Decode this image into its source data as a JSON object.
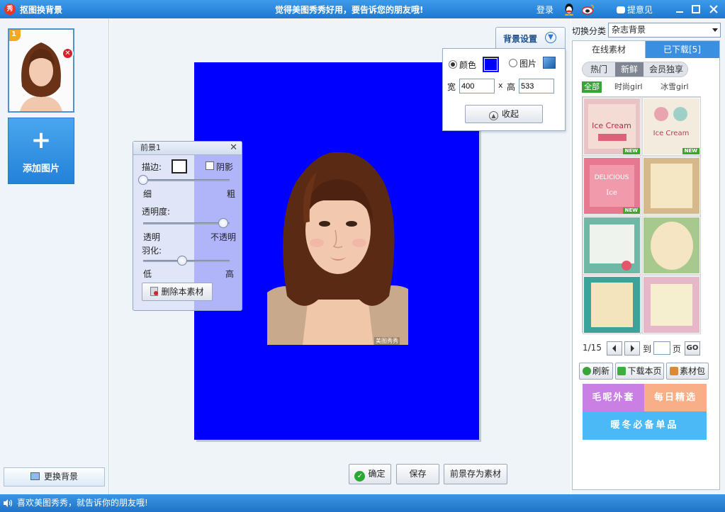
{
  "titlebar": {
    "logo": "秀",
    "title": "抠图换背景",
    "slogan": "觉得美图秀秀好用，要告诉您的朋友哦!",
    "login": "登录",
    "feedback": "提意见",
    "minimize_icon": "minimize-icon",
    "maximize_icon": "maximize-icon",
    "close_icon": "close-icon"
  },
  "left": {
    "thumb_badge": "1",
    "add_label": "添加图片",
    "add_plus": "+",
    "change_bg_label": "更换背景"
  },
  "canvas": {
    "bg_color": "#0000ff",
    "watermark": "美图秀秀"
  },
  "foreground_panel": {
    "title": "前景1",
    "stroke_label": "描边:",
    "shadow_label": "阴影",
    "thin": "细",
    "thick": "粗",
    "opacity_label": "透明度:",
    "transparent": "透明",
    "opaque": "不透明",
    "feather_label": "羽化:",
    "low": "低",
    "high": "高",
    "stroke_value": 0.0,
    "opacity_value": 0.93,
    "feather_value": 0.45,
    "delete_label": "删除本素材"
  },
  "bg_panel": {
    "tab_label": "背景设置",
    "color_label": "颜色",
    "image_label": "图片",
    "width_label": "宽",
    "width_value": "400",
    "x_label": "x",
    "height_label": "高",
    "height_value": "533",
    "collapse_label": "收起",
    "selected": "color"
  },
  "bottom_buttons": {
    "ok": "确定",
    "save": "保存",
    "save_as": "前景存为素材"
  },
  "right": {
    "category_label": "切换分类",
    "category_value": "杂志背景",
    "tabs": [
      {
        "label": "在线素材"
      },
      {
        "label": "已下载[5]"
      }
    ],
    "subtabs": [
      {
        "label": "热门"
      },
      {
        "label": "新鲜"
      },
      {
        "label": "会员独享"
      }
    ],
    "filters": [
      {
        "label": "全部"
      },
      {
        "label": "时尚girl"
      },
      {
        "label": "冰雪girl"
      }
    ],
    "tiles": [
      {
        "new": "NEW"
      },
      {
        "new": "NEW"
      },
      {
        "new": "NEW"
      },
      {
        "new": ""
      },
      {
        "new": ""
      },
      {
        "new": ""
      },
      {
        "new": ""
      },
      {
        "new": ""
      }
    ],
    "pager": {
      "page": "1/15",
      "to": "到",
      "unit": "页",
      "go": "GO"
    },
    "actions": {
      "refresh": "刷新",
      "download": "下载本页",
      "pack": "素材包"
    },
    "banner": {
      "a": "毛呢外套",
      "b": "每日精选",
      "c": "暖冬必备单品"
    }
  },
  "status": {
    "text": "喜欢美图秀秀，就告诉你的朋友哦!"
  }
}
